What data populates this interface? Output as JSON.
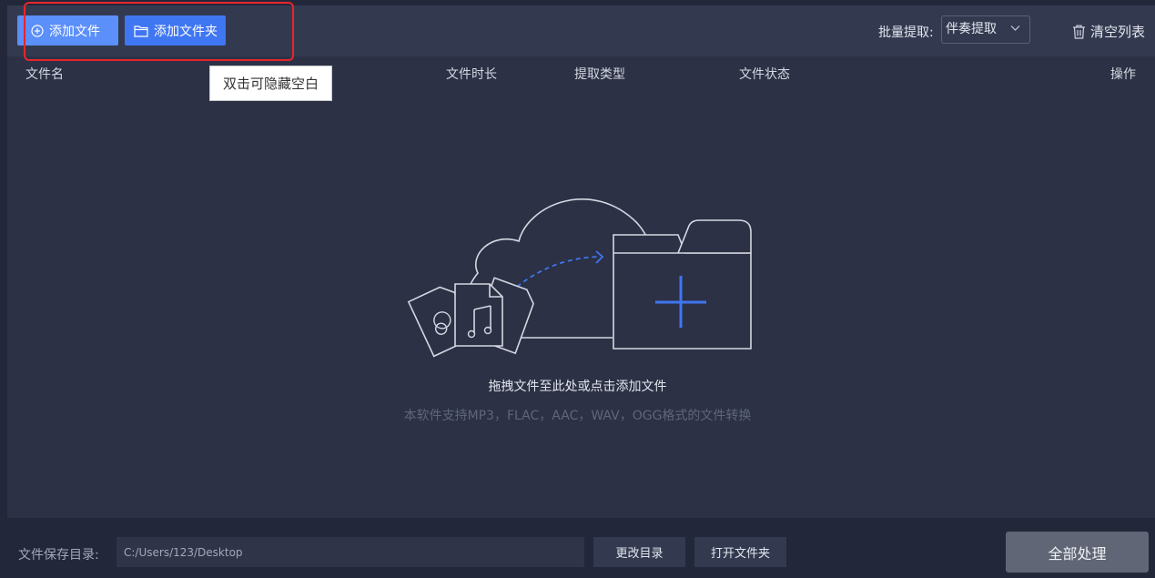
{
  "toolbar": {
    "add_file_label": "添加文件",
    "add_folder_label": "添加文件夹",
    "batch_label": "批量提取:",
    "batch_selected": "伴奏提取",
    "clear_list_label": "清空列表"
  },
  "table": {
    "columns": [
      "文件名",
      "文件时长",
      "提取类型",
      "文件状态",
      "操作"
    ]
  },
  "tooltip": {
    "text": "双击可隐藏空白"
  },
  "dropzone": {
    "title": "拖拽文件至此处或点击添加文件",
    "subtitle": "本软件支持MP3，FLAC，AAC，WAV，OGG格式的文件转换"
  },
  "footer": {
    "save_dir_label": "文件保存目录:",
    "save_dir_value": "C:/Users/123/Desktop",
    "change_dir_label": "更改目录",
    "open_folder_label": "打开文件夹",
    "process_all_label": "全部处理"
  },
  "colors": {
    "accent": "#3f76f2",
    "highlight": "#e8262a",
    "background": "#2c3145"
  }
}
